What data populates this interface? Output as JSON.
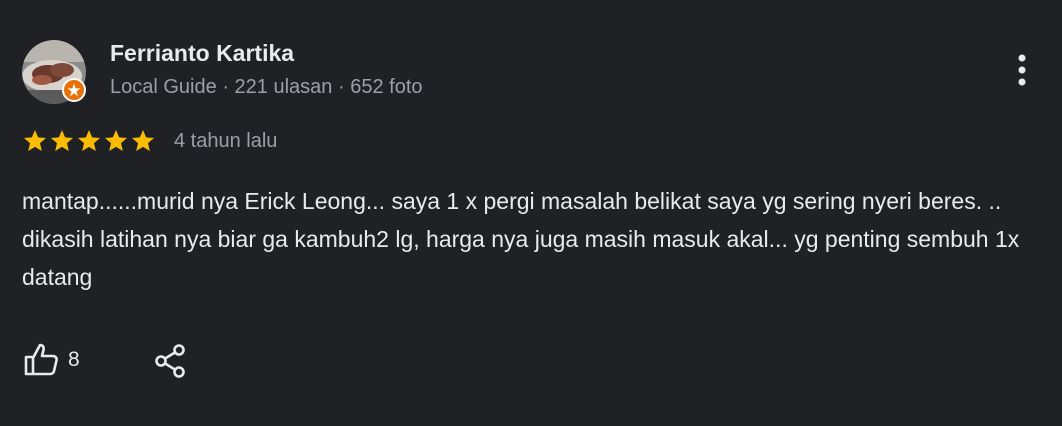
{
  "review": {
    "author": "Ferrianto Kartika",
    "badge": "Local Guide",
    "separator": "·",
    "reviews_count": "221 ulasan",
    "photos_count": "652 foto",
    "rating": 5,
    "rating_max": 5,
    "time_ago": "4 tahun lalu",
    "text": "mantap......murid nya Erick Leong... saya 1 x pergi masalah belikat saya yg sering nyeri beres. .. dikasih latihan nya biar ga kambuh2 lg, harga nya juga masih masuk akal... yg penting sembuh 1x datang",
    "likes": "8"
  },
  "icons": {
    "more": "more-vert-icon",
    "like": "thumbs-up-icon",
    "share": "share-icon",
    "star": "star-icon",
    "guide": "local-guide-badge-icon"
  },
  "colors": {
    "background": "#202124",
    "primary_text": "#e8eaed",
    "secondary_text": "#9aa0a6",
    "star": "#fbbc04",
    "badge": "#e8710a"
  }
}
